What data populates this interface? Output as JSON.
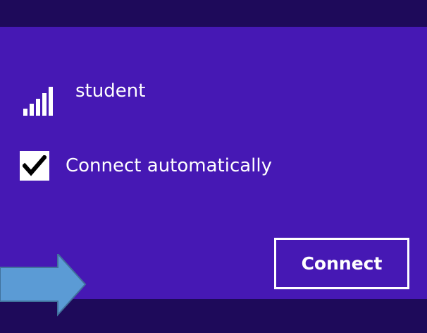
{
  "network": {
    "name": "student",
    "icon": "wifi-signal-icon",
    "signal_bars": 5
  },
  "auto_connect": {
    "label": "Connect automatically",
    "checked": true
  },
  "connect_button": {
    "label": "Connect"
  },
  "annotation": {
    "icon": "right-arrow-icon",
    "color": "#5b9bd5"
  },
  "colors": {
    "panel_background": "#4618b4",
    "strip_background": "#1e0a5a",
    "text": "#ffffff"
  }
}
